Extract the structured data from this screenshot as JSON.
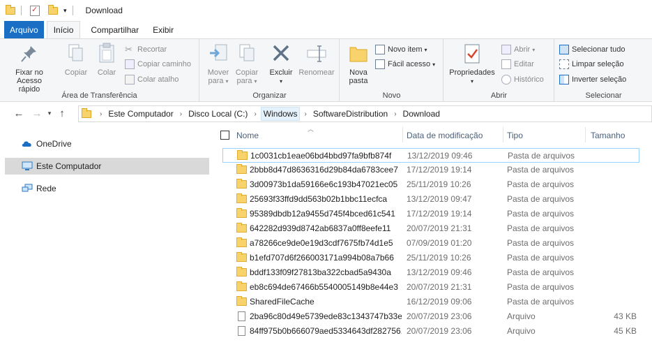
{
  "window": {
    "title": "Download"
  },
  "tabs": [
    {
      "label": "Arquivo"
    },
    {
      "label": "Início"
    },
    {
      "label": "Compartilhar"
    },
    {
      "label": "Exibir"
    }
  ],
  "ribbon": {
    "clipboard": {
      "label": "Área de Transferência",
      "pin": "Fixar no Acesso rápido",
      "copy": "Copiar",
      "paste": "Colar",
      "cut": "Recortar",
      "copy_path": "Copiar caminho",
      "paste_shortcut": "Colar atalho"
    },
    "organize": {
      "label": "Organizar",
      "move_to": "Mover para",
      "copy_to": "Copiar para",
      "delete": "Excluir",
      "rename": "Renomear"
    },
    "new": {
      "label": "Novo",
      "new_folder": "Nova pasta",
      "new_item": "Novo item",
      "easy_access": "Fácil acesso"
    },
    "open": {
      "label": "Abrir",
      "properties": "Propriedades",
      "open": "Abrir",
      "edit": "Editar",
      "history": "Histórico"
    },
    "select": {
      "label": "Selecionar",
      "select_all": "Selecionar tudo",
      "select_none": "Limpar seleção",
      "invert": "Inverter seleção"
    }
  },
  "address": {
    "crumbs": [
      "Este Computador",
      "Disco Local (C:)",
      "Windows",
      "SoftwareDistribution",
      "Download"
    ]
  },
  "navpane": {
    "items": [
      {
        "label": "OneDrive"
      },
      {
        "label": "Este Computador"
      },
      {
        "label": "Rede"
      }
    ]
  },
  "columns": {
    "name": "Nome",
    "date": "Data de modificação",
    "type": "Tipo",
    "size": "Tamanho"
  },
  "files": [
    {
      "name": "1c0031cb1eae06bd4bbd97fa9bfb874f",
      "date": "13/12/2019 09:46",
      "type": "Pasta de arquivos",
      "size": "",
      "kind": "folder"
    },
    {
      "name": "2bbb8d47d8636316d29b84da6783cee7",
      "date": "17/12/2019 19:14",
      "type": "Pasta de arquivos",
      "size": "",
      "kind": "folder"
    },
    {
      "name": "3d00973b1da59166e6c193b47021ec05",
      "date": "25/11/2019 10:26",
      "type": "Pasta de arquivos",
      "size": "",
      "kind": "folder"
    },
    {
      "name": "25693f33ffd9dd563b02b1bbc11ecfca",
      "date": "13/12/2019 09:47",
      "type": "Pasta de arquivos",
      "size": "",
      "kind": "folder"
    },
    {
      "name": "95389dbdb12a9455d745f4bced61c541",
      "date": "17/12/2019 19:14",
      "type": "Pasta de arquivos",
      "size": "",
      "kind": "folder"
    },
    {
      "name": "642282d939d8742ab6837a0ff8eefe11",
      "date": "20/07/2019 21:31",
      "type": "Pasta de arquivos",
      "size": "",
      "kind": "folder"
    },
    {
      "name": "a78266ce9de0e19d3cdf7675fb74d1e5",
      "date": "07/09/2019 01:20",
      "type": "Pasta de arquivos",
      "size": "",
      "kind": "folder"
    },
    {
      "name": "b1efd707d6f266003171a994b08a7b66",
      "date": "25/11/2019 10:26",
      "type": "Pasta de arquivos",
      "size": "",
      "kind": "folder"
    },
    {
      "name": "bddf133f09f27813ba322cbad5a9430a",
      "date": "13/12/2019 09:46",
      "type": "Pasta de arquivos",
      "size": "",
      "kind": "folder"
    },
    {
      "name": "eb8c694de67466b5540005149b8e44e3",
      "date": "20/07/2019 21:31",
      "type": "Pasta de arquivos",
      "size": "",
      "kind": "folder"
    },
    {
      "name": "SharedFileCache",
      "date": "16/12/2019 09:06",
      "type": "Pasta de arquivos",
      "size": "",
      "kind": "folder"
    },
    {
      "name": "2ba96c80d49e5739ede83c1343747b33e...",
      "date": "20/07/2019 23:06",
      "type": "Arquivo",
      "size": "43 KB",
      "kind": "file"
    },
    {
      "name": "84ff975b0b666079aed5334643df282756...",
      "date": "20/07/2019 23:06",
      "type": "Arquivo",
      "size": "45 KB",
      "kind": "file"
    }
  ],
  "colors": {
    "accent": "#1a6fc4",
    "folder": "#f8d26a",
    "selected_nav": "#d9d9d9",
    "focus_border": "#99d1ff"
  }
}
